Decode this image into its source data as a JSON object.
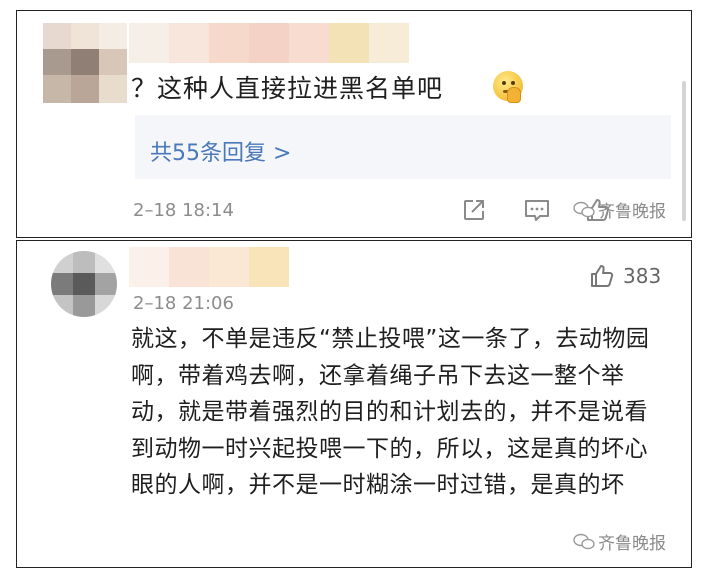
{
  "comment1": {
    "text": "？这种人直接拉进黑名单吧",
    "emoji": "thinking-face-emoji",
    "replies_label": "共55条回复 >",
    "timestamp": "2–18 18:14",
    "actions": [
      "share-icon",
      "comment-icon",
      "like-icon"
    ],
    "watermark": "齐鲁晚报"
  },
  "comment2": {
    "like_count": "383",
    "timestamp": "2–18 21:06",
    "text": "就这，不单是违反“禁止投喂”这一条了，去动物园啊，带着鸡去啊，还拿着绳子吊下去这一整个举动，就是带着强烈的目的和计划去的，并不是说看到动物一时兴起投喂一下的，所以，这是真的坏心眼的人啊，并不是一时糊涂一时过错，是真的坏",
    "watermark": "齐鲁晚报"
  },
  "colors": {
    "link": "#4a78b8",
    "text": "#1f1f1f",
    "meta": "#8c8c8c",
    "reply_bg": "#f4f6f9"
  }
}
